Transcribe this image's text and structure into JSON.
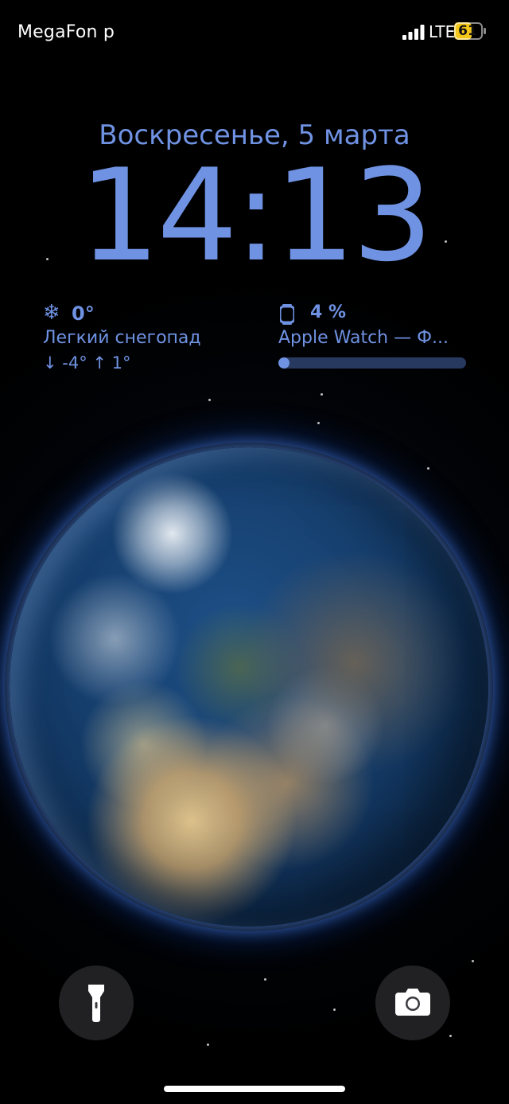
{
  "status_bar": {
    "carrier": "MegaFon p",
    "network": "LTE",
    "battery_level": "61",
    "battery_fraction": 0.61,
    "battery_color": "#f3c719"
  },
  "lock_screen": {
    "date": "Воскресенье, 5 марта",
    "time": "14:13",
    "accent_color": "#6f92e3"
  },
  "weather_widget": {
    "icon": "snowflake-icon",
    "temperature": "0°",
    "condition": "Легкий снегопад",
    "range": "↓ -4° ↑ 1°"
  },
  "watch_widget": {
    "icon": "apple-watch-icon",
    "battery_percent": "4 %",
    "battery_fraction": 0.04,
    "device_name": "Apple Watch — Ф..."
  },
  "buttons": {
    "flashlight": "flashlight-icon",
    "camera": "camera-icon"
  }
}
